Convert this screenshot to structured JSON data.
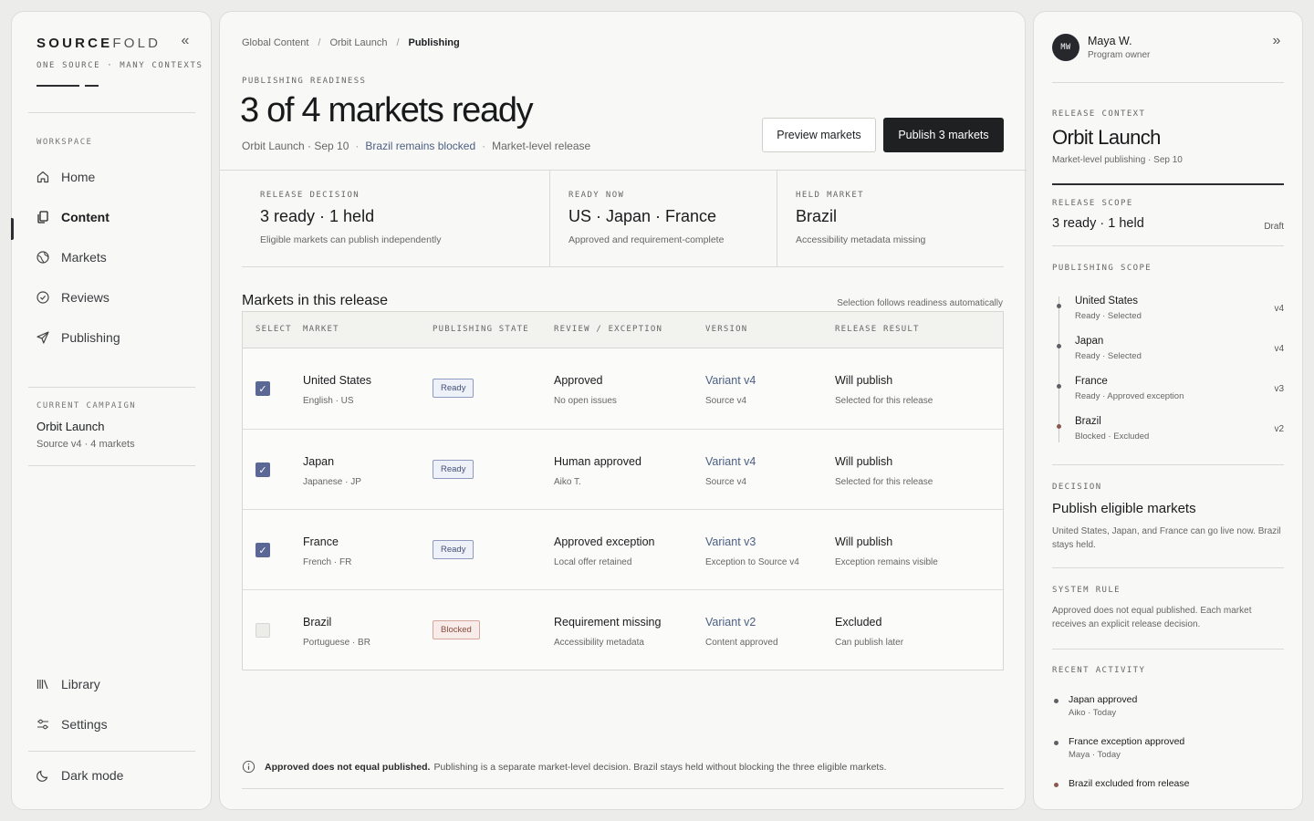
{
  "sidebar": {
    "logo_bold": "SOURCE",
    "logo_light": "FOLD",
    "tagline": "ONE SOURCE · MANY CONTEXTS",
    "workspace_label": "WORKSPACE",
    "nav": [
      {
        "label": "Home",
        "icon": "home-icon"
      },
      {
        "label": "Content",
        "icon": "documents-icon"
      },
      {
        "label": "Markets",
        "icon": "globe-icon"
      },
      {
        "label": "Reviews",
        "icon": "check-circle-icon"
      },
      {
        "label": "Publishing",
        "icon": "send-icon"
      }
    ],
    "current_campaign_label": "CURRENT CAMPAIGN",
    "campaign_title": "Orbit Launch",
    "campaign_sub": "Source v4 · 4 markets",
    "library_label": "Library",
    "settings_label": "Settings",
    "dark_mode_label": "Dark mode"
  },
  "main": {
    "breadcrumbs": [
      "Global Content",
      "Orbit Launch",
      "Publishing"
    ],
    "eyebrow": "PUBLISHING READINESS",
    "title": "3 of 4 markets ready",
    "sub_a": "Orbit Launch · Sep 10",
    "sub_warn": "Brazil remains blocked",
    "sub_c": "Market-level release",
    "preview_label": "Preview markets",
    "publish_label": "Publish 3 markets",
    "stats": [
      {
        "label": "RELEASE DECISION",
        "value": "3 ready · 1 held",
        "sub": "Eligible markets can publish independently"
      },
      {
        "label": "READY NOW",
        "value": "US · Japan · France",
        "sub": "Approved and requirement-complete"
      },
      {
        "label": "HELD MARKET",
        "value": "Brazil",
        "sub": "Accessibility metadata missing"
      }
    ],
    "table_title": "Markets in this release",
    "table_note": "Selection follows readiness automatically",
    "columns": [
      "SELECT",
      "MARKET",
      "PUBLISHING STATE",
      "REVIEW / EXCEPTION",
      "VERSION",
      "RELEASE RESULT"
    ],
    "rows": [
      {
        "checked": true,
        "market": "United States",
        "lang": "English · US",
        "state": "Ready",
        "review": "Approved",
        "review_sub": "No open issues",
        "version": "Variant v4",
        "version_sub": "Source v4",
        "result": "Will publish",
        "result_sub": "Selected for this release"
      },
      {
        "checked": true,
        "market": "Japan",
        "lang": "Japanese · JP",
        "state": "Ready",
        "review": "Human approved",
        "review_sub": "Aiko T.",
        "version": "Variant v4",
        "version_sub": "Source v4",
        "result": "Will publish",
        "result_sub": "Selected for this release"
      },
      {
        "checked": true,
        "market": "France",
        "lang": "French · FR",
        "state": "Ready",
        "review": "Approved exception",
        "review_sub": "Local offer retained",
        "version": "Variant v3",
        "version_sub": "Exception to Source v4",
        "result": "Will publish",
        "result_sub": "Exception remains visible"
      },
      {
        "checked": false,
        "market": "Brazil",
        "lang": "Portuguese · BR",
        "state": "Blocked",
        "review": "Requirement missing",
        "review_sub": "Accessibility metadata",
        "version": "Variant v2",
        "version_sub": "Content approved",
        "result": "Excluded",
        "result_sub": "Can publish later"
      }
    ],
    "footnote_bold": "Approved does not equal published.",
    "footnote_rest": "Publishing is a separate market-level decision. Brazil stays held without blocking the three eligible markets."
  },
  "right": {
    "avatar_initials": "MW",
    "user_name": "Maya W.",
    "user_role": "Program owner",
    "release_context_label": "RELEASE CONTEXT",
    "release_title": "Orbit Launch",
    "release_sub": "Market-level publishing · Sep 10",
    "scope_label": "RELEASE SCOPE",
    "scope_value": "3 ready · 1 held",
    "scope_status": "Draft",
    "publishing_scope_label": "PUBLISHING SCOPE",
    "timeline": [
      {
        "name": "United States",
        "sub": "Ready · Selected",
        "ver": "v4"
      },
      {
        "name": "Japan",
        "sub": "Ready · Selected",
        "ver": "v4"
      },
      {
        "name": "France",
        "sub": "Ready · Approved exception",
        "ver": "v3"
      },
      {
        "name": "Brazil",
        "sub": "Blocked · Excluded",
        "ver": "v2"
      }
    ],
    "decision_label": "DECISION",
    "decision_title": "Publish eligible markets",
    "decision_text": "United States, Japan, and France can go live now. Brazil stays held.",
    "system_rule_label": "SYSTEM RULE",
    "system_rule_text": "Approved does not equal published. Each market receives an explicit release decision.",
    "activity_label": "RECENT ACTIVITY",
    "activity": [
      {
        "title": "Japan approved",
        "sub": "Aiko · Today"
      },
      {
        "title": "France exception approved",
        "sub": "Maya · Today"
      },
      {
        "title": "Brazil excluded from release",
        "sub": ""
      }
    ]
  },
  "colors": {
    "accent": "#5b6795",
    "primary_button": "#1f2022",
    "ready_badge": "#44507a",
    "blocked_badge": "#8a4a3c"
  }
}
